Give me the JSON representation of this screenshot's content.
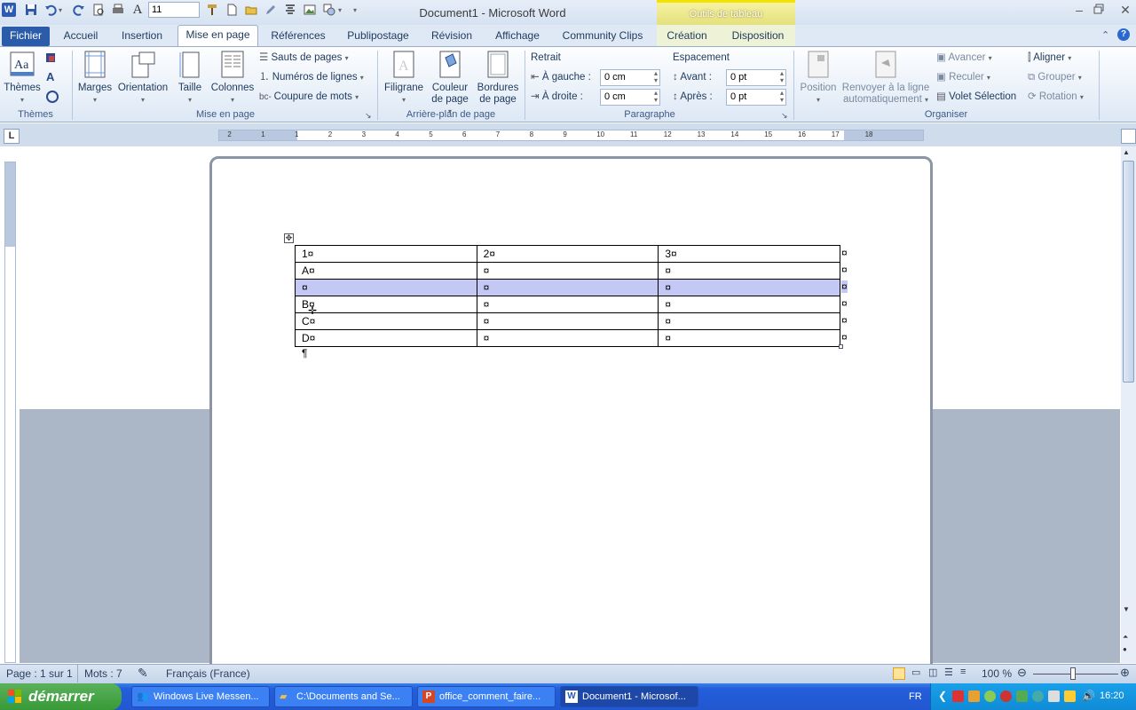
{
  "window": {
    "title": "Document1  -  Microsoft Word",
    "context_tab_group": "Outils de tableau"
  },
  "quick_access": {
    "font_size": "11"
  },
  "tabs": [
    {
      "label": "Fichier"
    },
    {
      "label": "Accueil"
    },
    {
      "label": "Insertion"
    },
    {
      "label": "Mise en page"
    },
    {
      "label": "Références"
    },
    {
      "label": "Publipostage"
    },
    {
      "label": "Révision"
    },
    {
      "label": "Affichage"
    },
    {
      "label": "Community Clips"
    },
    {
      "label": "Création"
    },
    {
      "label": "Disposition"
    }
  ],
  "ribbon": {
    "themes": {
      "button": "Thèmes",
      "group": "Thèmes"
    },
    "mise_en_page": {
      "marges": "Marges",
      "orientation": "Orientation",
      "taille": "Taille",
      "colonnes": "Colonnes",
      "sauts": "Sauts de pages",
      "numeros": "Numéros de lignes",
      "coupure": "Coupure de mots",
      "group": "Mise en page"
    },
    "arriere_plan": {
      "filigrane": "Filigrane",
      "couleur_1": "Couleur",
      "couleur_2": "de page",
      "bordures_1": "Bordures",
      "bordures_2": "de page",
      "group": "Arrière-plan de page"
    },
    "paragraphe": {
      "retrait": "Retrait",
      "gauche_label": "À gauche :",
      "gauche_value": "0 cm",
      "droite_label": "À droite :",
      "droite_value": "0 cm",
      "espacement": "Espacement",
      "avant_label": "Avant :",
      "avant_value": "0  pt",
      "apres_label": "Après :",
      "apres_value": "0  pt",
      "group": "Paragraphe"
    },
    "organiser": {
      "position": "Position",
      "renvoyer_1": "Renvoyer à la ligne",
      "renvoyer_2": "automatiquement",
      "avancer": "Avancer",
      "reculer": "Reculer",
      "volet": "Volet Sélection",
      "aligner": "Aligner",
      "grouper": "Grouper",
      "rotation": "Rotation",
      "group": "Organiser"
    }
  },
  "ruler": {
    "h_marks": [
      "2",
      "1",
      "1",
      "2",
      "3",
      "4",
      "5",
      "6",
      "7",
      "8",
      "9",
      "10",
      "11",
      "12",
      "13",
      "14",
      "15",
      "16",
      "17",
      "18"
    ]
  },
  "document": {
    "table_rows": [
      [
        "1¤",
        "2¤",
        "3¤"
      ],
      [
        "A¤",
        "¤",
        "¤"
      ],
      [
        "¤",
        "¤",
        "¤"
      ],
      [
        "B¤",
        "¤",
        "¤"
      ],
      [
        "C¤",
        "¤",
        "¤"
      ],
      [
        "D¤",
        "¤",
        "¤"
      ]
    ],
    "row_end_mark": "¤",
    "paragraph_mark": "¶"
  },
  "status": {
    "page": "Page : 1 sur 1",
    "words": "Mots : 7",
    "language": "Français (France)",
    "zoom": "100 %"
  },
  "taskbar": {
    "start": "démarrer",
    "tasks": [
      "Windows Live Messen...",
      "C:\\Documents and Se...",
      "office_comment_faire...",
      "Document1 - Microsof..."
    ],
    "lang": "FR",
    "clock": "16:20"
  }
}
